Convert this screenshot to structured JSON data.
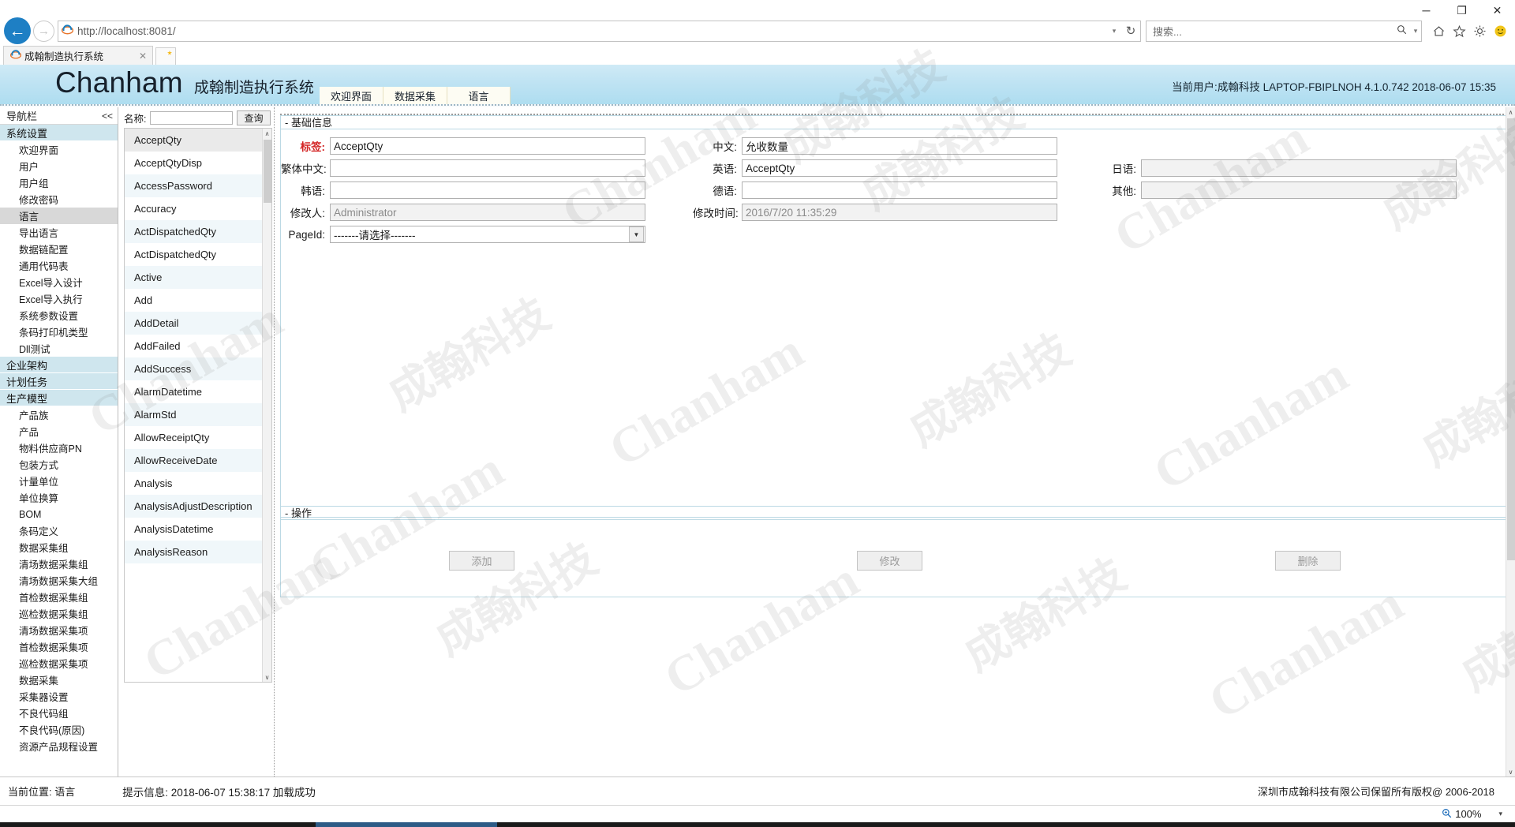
{
  "browser": {
    "window_controls": {
      "minimize": "─",
      "maximize": "❐",
      "close": "✕"
    },
    "back_icon": "←",
    "forward_icon": "→",
    "url_scheme": "http://",
    "url_host": "localhost:8081",
    "url_path": "/",
    "url_full": "http://localhost:8081/",
    "reload_icon": "↻",
    "address_caret": "▾",
    "search_placeholder": "搜索...",
    "search_caret": "▾",
    "toolbar_icons": [
      "home-icon",
      "favorites-star-icon",
      "settings-gear-icon",
      "smiley-icon"
    ],
    "tab": {
      "title": "成翰制造执行系统",
      "close": "✕"
    },
    "new_tab_tooltip": "新建选项卡"
  },
  "banner": {
    "brand": "Chanham",
    "brand_sub": "成翰制造执行系统",
    "tabs": [
      {
        "label": "欢迎界面",
        "selected": false
      },
      {
        "label": "数据采集",
        "selected": true
      },
      {
        "label": "语言",
        "selected": false
      }
    ],
    "user_info": "当前用户:成翰科技 LAPTOP-FBIPLNOH  4.1.0.742  2018-06-07 15:35"
  },
  "nav": {
    "title": "导航栏",
    "collapse": "<<",
    "groups": [
      {
        "label": "系统设置",
        "items": [
          "欢迎界面",
          "用户",
          "用户组",
          "修改密码",
          "语言",
          "导出语言",
          "数据链配置",
          "通用代码表",
          "Excel导入设计",
          "Excel导入执行",
          "系统参数设置",
          "条码打印机类型",
          "Dll测试"
        ],
        "selected_item": "语言"
      },
      {
        "label": "企业架构",
        "items": []
      },
      {
        "label": "计划任务",
        "items": []
      },
      {
        "label": "生产模型",
        "items": [
          "产品族",
          "产品",
          "物料供应商PN",
          "包装方式",
          "计量单位",
          "单位换算",
          "BOM",
          "条码定义",
          "数据采集组",
          "清场数据采集组",
          "清场数据采集大组",
          "首检数据采集组",
          "巡检数据采集组",
          "清场数据采集项",
          "首检数据采集项",
          "巡检数据采集项",
          "数据采集",
          "采集器设置",
          "不良代码组",
          "不良代码(原因)",
          "资源产品规程设置"
        ],
        "selected_item": ""
      }
    ]
  },
  "list_panel": {
    "search_label": "名称:",
    "search_value": "",
    "search_button": "查询",
    "selected": "AcceptQty",
    "items": [
      "AcceptQty",
      "AcceptQtyDisp",
      "AccessPassword",
      "Accuracy",
      "ActDispatchedQty",
      "ActDispatchedQty",
      "Active",
      "Add",
      "AddDetail",
      "AddFailed",
      "AddSuccess",
      "AlarmDatetime",
      "AlarmStd",
      "AllowReceiptQty",
      "AllowReceiveDate",
      "Analysis",
      "AnalysisAdjustDescription",
      "AnalysisDatetime",
      "AnalysisReason"
    ],
    "scroll_up": "∧",
    "scroll_down": "∨"
  },
  "form": {
    "basic_legend": "- 基础信息",
    "fields": {
      "label_cn": "标签:",
      "label_value": "AcceptQty",
      "zh_cn": "中文:",
      "zh_cn_value": "允收数量",
      "traditional": "繁体中文:",
      "traditional_value": "",
      "english": "英语:",
      "english_value": "AcceptQty",
      "japanese": "日语:",
      "japanese_value": "",
      "korean": "韩语:",
      "korean_value": "",
      "german": "德语:",
      "german_value": "",
      "other": "其他:",
      "other_value": "",
      "modifier": "修改人:",
      "modifier_value": "Administrator",
      "modify_time": "修改时间:",
      "modify_time_value": "2016/7/20 11:35:29",
      "page_id": "PageId:",
      "page_id_value": "-------请选择-------",
      "dropdown_caret": "▼"
    }
  },
  "operation": {
    "legend": "- 操作",
    "buttons": [
      {
        "label": "添加",
        "name": "add-button"
      },
      {
        "label": "修改",
        "name": "modify-button"
      },
      {
        "label": "删除",
        "name": "delete-button"
      }
    ]
  },
  "status": {
    "position_label": "当前位置:  语言",
    "message": "提示信息: 2018-06-07 15:38:17 加载成功",
    "copyright": "深圳市成翰科技有限公司保留所有版权@ 2006-2018",
    "zoom": "100%",
    "zoom_caret": "▾"
  },
  "watermark": {
    "en": "Chanham",
    "cn": "成翰科技"
  },
  "colors": {
    "banner_top": "#cfeaf6",
    "banner_bottom": "#aeddf0",
    "nav_group": "#cfe6ee",
    "list_alt_row": "#f0f7fa",
    "required_label": "#d32424",
    "accent_blue": "#1e7fc4"
  }
}
